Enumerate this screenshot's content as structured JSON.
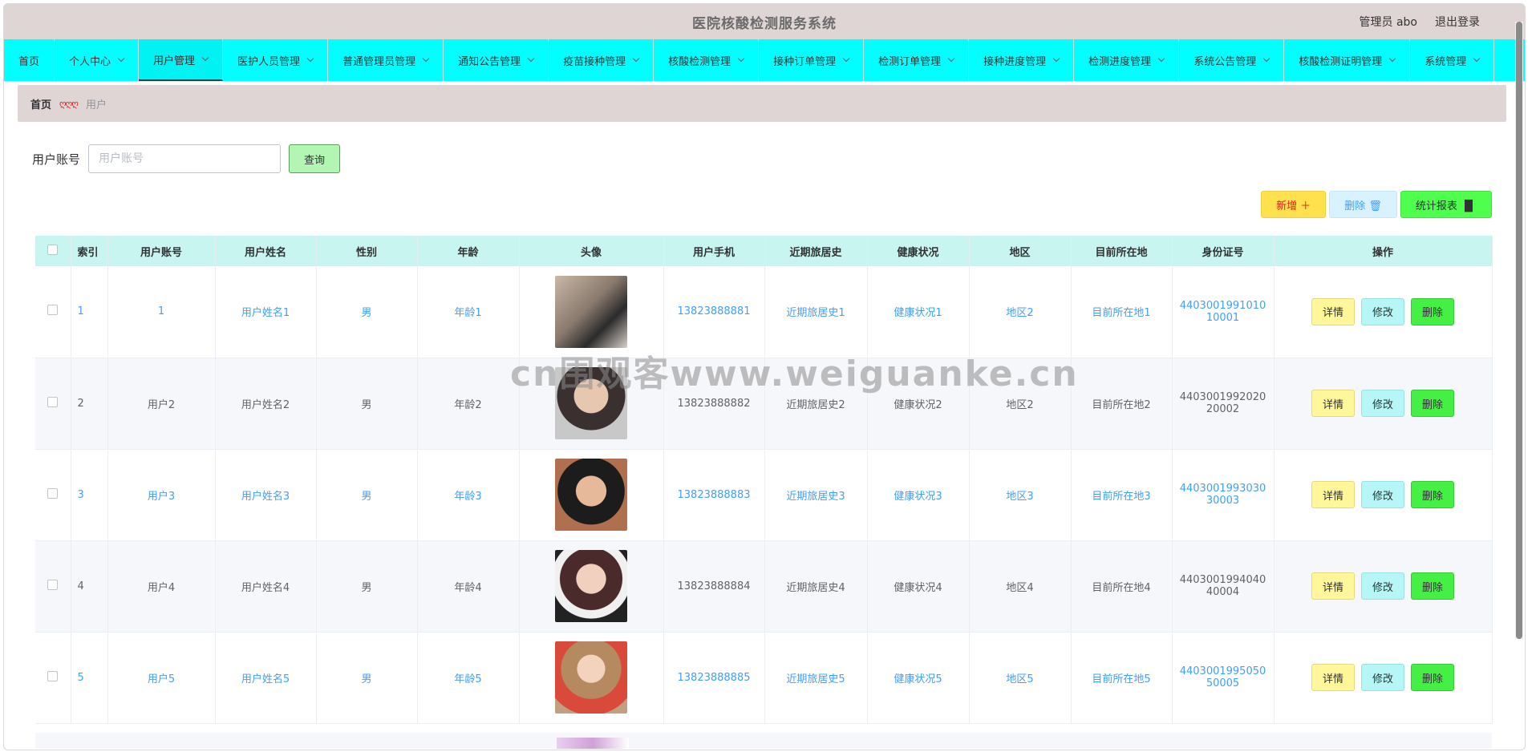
{
  "app": {
    "title": "医院核酸检测服务系统",
    "user": "管理员 abo",
    "logout": "退出登录"
  },
  "nav": [
    {
      "label": "首页",
      "dropdown": false,
      "active": false
    },
    {
      "label": "个人中心",
      "dropdown": true,
      "active": false
    },
    {
      "label": "用户管理",
      "dropdown": true,
      "active": true
    },
    {
      "label": "医护人员管理",
      "dropdown": true,
      "active": false
    },
    {
      "label": "普通管理员管理",
      "dropdown": true,
      "active": false
    },
    {
      "label": "通知公告管理",
      "dropdown": true,
      "active": false
    },
    {
      "label": "疫苗接种管理",
      "dropdown": true,
      "active": false
    },
    {
      "label": "核酸检测管理",
      "dropdown": true,
      "active": false
    },
    {
      "label": "接种订单管理",
      "dropdown": true,
      "active": false
    },
    {
      "label": "检测订单管理",
      "dropdown": true,
      "active": false
    },
    {
      "label": "接种进度管理",
      "dropdown": true,
      "active": false
    },
    {
      "label": "检测进度管理",
      "dropdown": true,
      "active": false
    },
    {
      "label": "系统公告管理",
      "dropdown": true,
      "active": false
    },
    {
      "label": "核酸检测证明管理",
      "dropdown": true,
      "active": false
    },
    {
      "label": "系统管理",
      "dropdown": true,
      "active": false
    }
  ],
  "breadcrumb": {
    "home": "首页",
    "separator": "ღღღ",
    "current": "用户"
  },
  "search": {
    "label": "用户账号",
    "placeholder": "用户账号",
    "value": "",
    "button": "查询"
  },
  "actions": {
    "add": "新增 ＋",
    "delete": "删除 🗑",
    "stats": "统计报表 ▐▌"
  },
  "table": {
    "columns": [
      "索引",
      "用户账号",
      "用户姓名",
      "性别",
      "年龄",
      "头像",
      "用户手机",
      "近期旅居史",
      "健康状况",
      "地区",
      "目前所在地",
      "身份证号",
      "操作"
    ],
    "rows": [
      {
        "index": "1",
        "account": "1",
        "name": "用户姓名1",
        "gender": "男",
        "age": "年龄1",
        "phone": "13823888881",
        "travel": "近期旅居史1",
        "health": "健康状况1",
        "region": "地区2",
        "location": "目前所在地1",
        "idcard": "440300199101010001"
      },
      {
        "index": "2",
        "account": "用户2",
        "name": "用户姓名2",
        "gender": "男",
        "age": "年龄2",
        "phone": "13823888882",
        "travel": "近期旅居史2",
        "health": "健康状况2",
        "region": "地区2",
        "location": "目前所在地2",
        "idcard": "440300199202020002"
      },
      {
        "index": "3",
        "account": "用户3",
        "name": "用户姓名3",
        "gender": "男",
        "age": "年龄3",
        "phone": "13823888883",
        "travel": "近期旅居史3",
        "health": "健康状况3",
        "region": "地区3",
        "location": "目前所在地3",
        "idcard": "440300199303030003"
      },
      {
        "index": "4",
        "account": "用户4",
        "name": "用户姓名4",
        "gender": "男",
        "age": "年龄4",
        "phone": "13823888884",
        "travel": "近期旅居史4",
        "health": "健康状况4",
        "region": "地区4",
        "location": "目前所在地4",
        "idcard": "440300199404040004"
      },
      {
        "index": "5",
        "account": "用户5",
        "name": "用户姓名5",
        "gender": "男",
        "age": "年龄5",
        "phone": "13823888885",
        "travel": "近期旅居史5",
        "health": "健康状况5",
        "region": "地区5",
        "location": "目前所在地5",
        "idcard": "440300199505050005"
      }
    ],
    "row_actions": {
      "detail": "详情",
      "edit": "修改",
      "delete": "删除"
    }
  },
  "watermark": "cn围观客www.weiguanke.cn"
}
